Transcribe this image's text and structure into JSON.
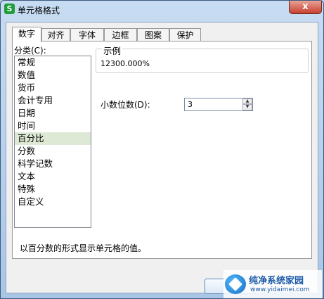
{
  "window": {
    "title": "单元格格式",
    "app_icon_letter": "S",
    "close_symbol": "x"
  },
  "tabs": [
    "数字",
    "对齐",
    "字体",
    "边框",
    "图案",
    "保护"
  ],
  "category": {
    "label": "分类(C):",
    "items": [
      "常规",
      "数值",
      "货币",
      "会计专用",
      "日期",
      "时间",
      "百分比",
      "分数",
      "科学记数",
      "文本",
      "特殊",
      "自定义"
    ],
    "selected": "百分比"
  },
  "sample": {
    "title": "示例",
    "value": "12300.000%"
  },
  "decimal": {
    "label": "小数位数(D):",
    "value": "3"
  },
  "description": "以百分数的形式显示单元格的值。",
  "watermark": {
    "title": "纯净系统家园",
    "url": "www.yidaimei.com"
  }
}
